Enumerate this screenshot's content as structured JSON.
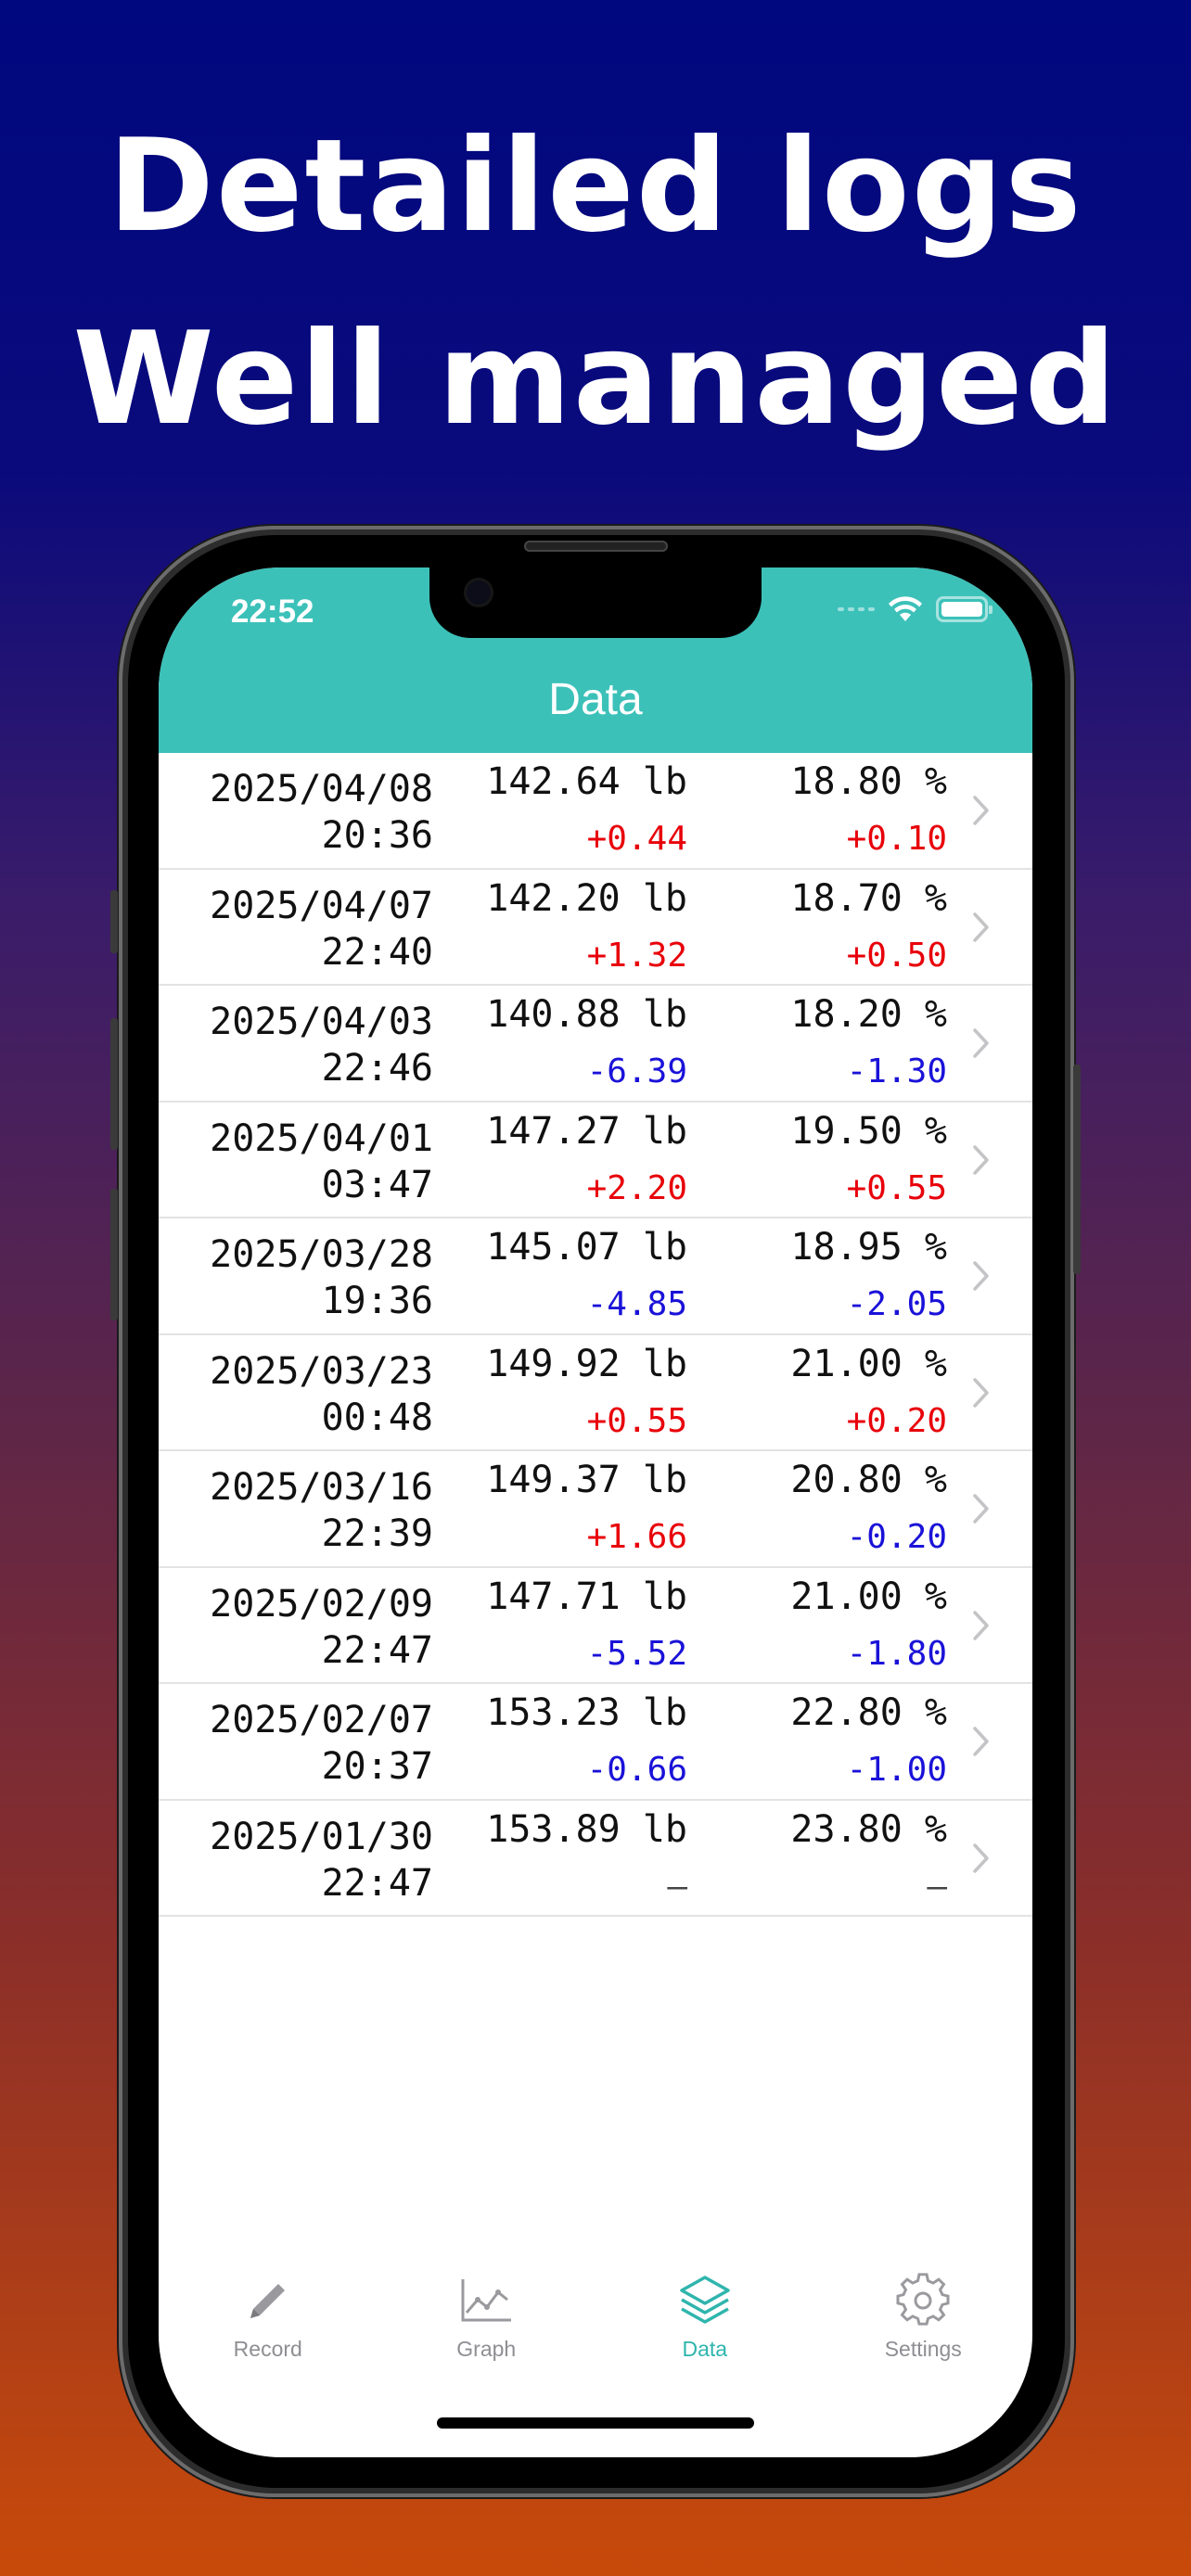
{
  "promo": {
    "line1": "Detailed logs",
    "line2": "Well managed"
  },
  "status_bar": {
    "time": "22:52"
  },
  "nav": {
    "title": "Data"
  },
  "rows": [
    {
      "date": "2025/04/08",
      "time": "20:36",
      "weight": "142.64 lb",
      "weight_diff": "+0.44",
      "fat": "18.80 %",
      "fat_diff": "+0.10"
    },
    {
      "date": "2025/04/07",
      "time": "22:40",
      "weight": "142.20 lb",
      "weight_diff": "+1.32",
      "fat": "18.70 %",
      "fat_diff": "+0.50"
    },
    {
      "date": "2025/04/03",
      "time": "22:46",
      "weight": "140.88 lb",
      "weight_diff": "-6.39",
      "fat": "18.20 %",
      "fat_diff": "-1.30"
    },
    {
      "date": "2025/04/01",
      "time": "03:47",
      "weight": "147.27 lb",
      "weight_diff": "+2.20",
      "fat": "19.50 %",
      "fat_diff": "+0.55"
    },
    {
      "date": "2025/03/28",
      "time": "19:36",
      "weight": "145.07 lb",
      "weight_diff": "-4.85",
      "fat": "18.95 %",
      "fat_diff": "-2.05"
    },
    {
      "date": "2025/03/23",
      "time": "00:48",
      "weight": "149.92 lb",
      "weight_diff": "+0.55",
      "fat": "21.00 %",
      "fat_diff": "+0.20"
    },
    {
      "date": "2025/03/16",
      "time": "22:39",
      "weight": "149.37 lb",
      "weight_diff": "+1.66",
      "fat": "20.80 %",
      "fat_diff": "-0.20"
    },
    {
      "date": "2025/02/09",
      "time": "22:47",
      "weight": "147.71 lb",
      "weight_diff": "-5.52",
      "fat": "21.00 %",
      "fat_diff": "-1.80"
    },
    {
      "date": "2025/02/07",
      "time": "20:37",
      "weight": "153.23 lb",
      "weight_diff": "-0.66",
      "fat": "22.80 %",
      "fat_diff": "-1.00"
    },
    {
      "date": "2025/01/30",
      "time": "22:47",
      "weight": "153.89 lb",
      "weight_diff": "–",
      "fat": "23.80 %",
      "fat_diff": "–"
    }
  ],
  "tabs": [
    {
      "label": "Record",
      "icon": "pencil-icon",
      "active": false
    },
    {
      "label": "Graph",
      "icon": "chart-line-icon",
      "active": false
    },
    {
      "label": "Data",
      "icon": "layers-icon",
      "active": true
    },
    {
      "label": "Settings",
      "icon": "gear-icon",
      "active": false
    }
  ],
  "colors": {
    "accent": "#3cc1b9",
    "positive_diff": "#e8000a",
    "negative_diff": "#1a12d8",
    "tab_active": "#2fb5ad",
    "tab_inactive": "#8e8e93"
  }
}
